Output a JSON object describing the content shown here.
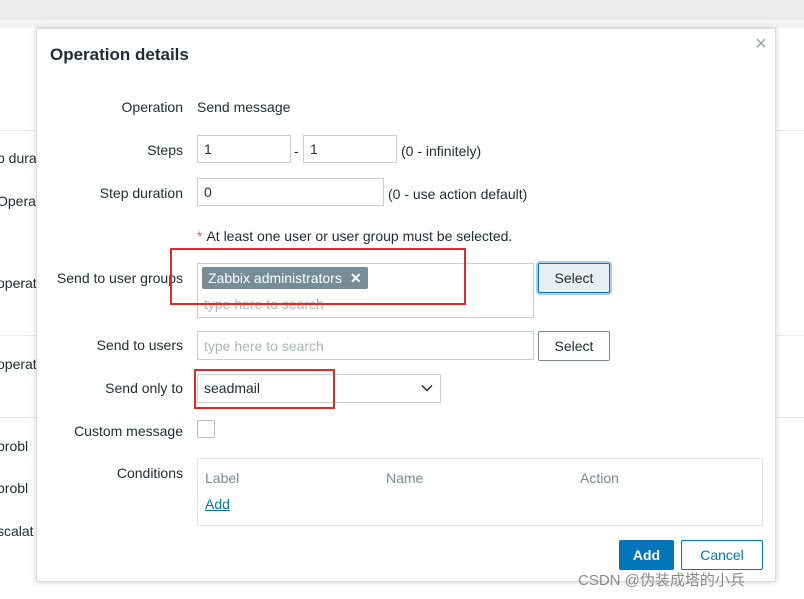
{
  "background": {
    "labels": [
      "p dura",
      "Operat",
      "operat",
      "operat",
      "probl",
      "probl",
      "scalat"
    ]
  },
  "dialog": {
    "title": "Operation details",
    "close_glyph": "×"
  },
  "form": {
    "operation": {
      "label": "Operation",
      "value": "Send message"
    },
    "steps": {
      "label": "Steps",
      "from": "1",
      "separator": "-",
      "to": "1",
      "hint": "(0 - infinitely)"
    },
    "step_duration": {
      "label": "Step duration",
      "value": "0",
      "hint": "(0 - use action default)"
    },
    "required_note": {
      "star": "*",
      "text": "At least one user or user group must be selected."
    },
    "user_groups": {
      "label": "Send to user groups",
      "selected": [
        "Zabbix administrators"
      ],
      "remove_glyph": "✕",
      "placeholder": "type here to search",
      "select_button": "Select"
    },
    "users": {
      "label": "Send to users",
      "placeholder": "type here to search",
      "select_button": "Select"
    },
    "send_only_to": {
      "label": "Send only to",
      "value": "seadmail"
    },
    "custom_message": {
      "label": "Custom message",
      "checked": false
    },
    "conditions": {
      "label": "Conditions",
      "headers": [
        "Label",
        "Name",
        "Action"
      ],
      "add_link": "Add"
    }
  },
  "footer": {
    "add_button": "Add",
    "cancel_button": "Cancel"
  },
  "colors": {
    "primary": "#0275b8",
    "tag_bg": "#768d99",
    "annotation": "#e02a2a",
    "required": "#e45959"
  },
  "watermark": "CSDN @伪装成塔的小兵"
}
